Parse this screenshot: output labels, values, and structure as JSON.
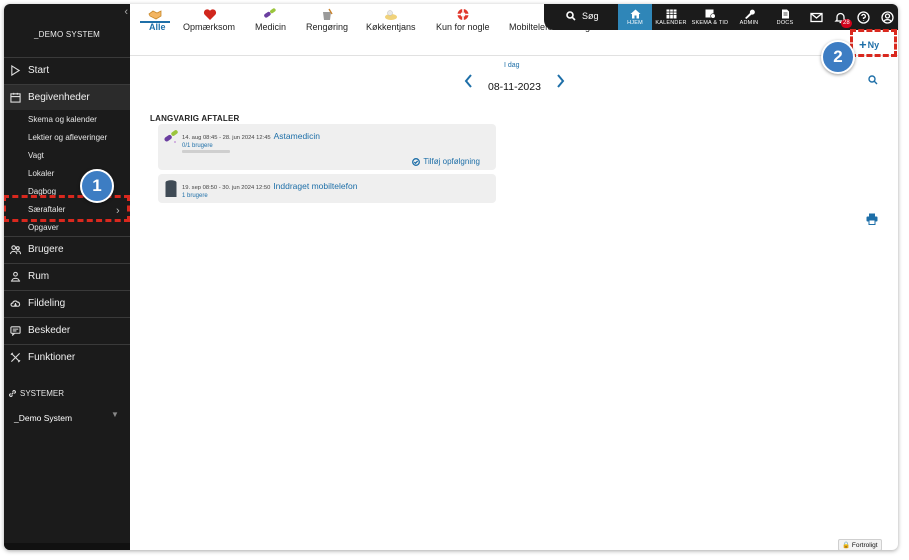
{
  "sidebar": {
    "brand": "_DEMO SYSTEM",
    "items": [
      {
        "label": "Start",
        "icon": "play-icon"
      },
      {
        "label": "Begivenheder",
        "icon": "calendar-icon"
      },
      {
        "label": "Brugere",
        "icon": "users-icon"
      },
      {
        "label": "Rum",
        "icon": "room-icon"
      },
      {
        "label": "Fildeling",
        "icon": "cloud-icon"
      },
      {
        "label": "Beskeder",
        "icon": "message-icon"
      },
      {
        "label": "Funktioner",
        "icon": "tools-icon"
      }
    ],
    "subitems": [
      "Skema og kalender",
      "Lektier og afleveringer",
      "Vagt",
      "Lokaler",
      "Dagbog",
      "Særaftaler",
      "Opgaver"
    ],
    "systems_label": "SYSTEMER",
    "system_name": "_Demo System"
  },
  "topbar": {
    "search_label": "Søg",
    "home_label": "HJEM",
    "calendar_label": "KALENDER",
    "schedule_label": "SKEMA & TID",
    "admin_label": "ADMIN",
    "docs_label": "DOCS",
    "notification_count": "28"
  },
  "tabs": [
    {
      "label": "Alle",
      "icon": "handshake-icon"
    },
    {
      "label": "Opmærksom",
      "icon": "heart-icon"
    },
    {
      "label": "Medicin",
      "icon": "pills-icon"
    },
    {
      "label": "Rengøring",
      "icon": "bucket-icon"
    },
    {
      "label": "Køkkentjans",
      "icon": "dish-icon"
    },
    {
      "label": "Kun for nogle",
      "icon": "lifebuoy-icon"
    },
    {
      "label": "Mobiltelefon inddraget",
      "icon": "phone-icon"
    }
  ],
  "new_button": {
    "plus": "+",
    "label": "Ny"
  },
  "date_nav": {
    "today": "I dag",
    "date": "08-11-2023"
  },
  "section_title": "LANGVARIG AFTALER",
  "appointments": [
    {
      "period": "14. aug 08:45 - 28. jun 2024 12:45",
      "name": "Astamedicin",
      "users": "0/1 brugere",
      "progress": 0,
      "followup": "Tilføj opfølgning"
    },
    {
      "period": "19. sep 08:50 - 30. jun 2024 12:50",
      "name": "Inddraget mobiltelefon",
      "users": "1 brugere"
    }
  ],
  "confidential": "Fortroligt",
  "callouts": [
    "1",
    "2"
  ],
  "colors": {
    "accent": "#1e6fa8",
    "sidebar": "#1b1b1b",
    "home": "#2f86b8",
    "annotation": "#d9281e",
    "callout": "#3d7dc3"
  }
}
